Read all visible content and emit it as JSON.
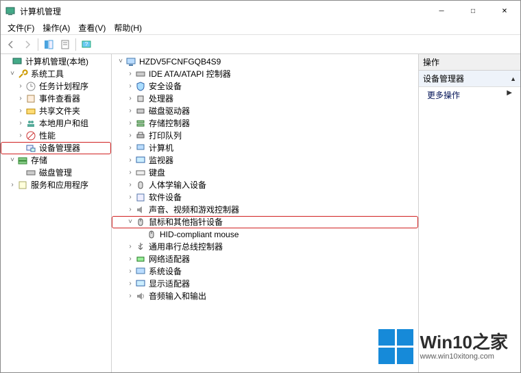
{
  "window": {
    "title": "计算机管理",
    "btn_min": "─",
    "btn_max": "□",
    "btn_close": "✕"
  },
  "menu": {
    "file": "文件(F)",
    "action": "操作(A)",
    "view": "查看(V)",
    "help": "帮助(H)"
  },
  "left_tree": {
    "root": "计算机管理(本地)",
    "sys": "系统工具",
    "sched": "任务计划程序",
    "event": "事件查看器",
    "share": "共享文件夹",
    "users": "本地用户和组",
    "perf": "性能",
    "devmgr": "设备管理器",
    "storage": "存储",
    "disk": "磁盘管理",
    "svc": "服务和应用程序"
  },
  "dev_tree": {
    "host": "HZDV5FCNFGQB4S9",
    "ide": "IDE ATA/ATAPI 控制器",
    "sec": "安全设备",
    "cpu": "处理器",
    "diskdrv": "磁盘驱动器",
    "storctl": "存储控制器",
    "printq": "打印队列",
    "computer": "计算机",
    "monitor": "监视器",
    "keyboard": "键盘",
    "hid": "人体学输入设备",
    "softdev": "软件设备",
    "avgame": "声音、视频和游戏控制器",
    "mouse": "鼠标和其他指针设备",
    "mouse_child": "HID-compliant mouse",
    "usb": "通用串行总线控制器",
    "net": "网络适配器",
    "sysdev": "系统设备",
    "display": "显示适配器",
    "audio": "音频输入和输出"
  },
  "actions": {
    "header": "操作",
    "section": "设备管理器",
    "more": "更多操作"
  },
  "watermark": {
    "title": "Win10之家",
    "url": "www.win10xitong.com"
  }
}
